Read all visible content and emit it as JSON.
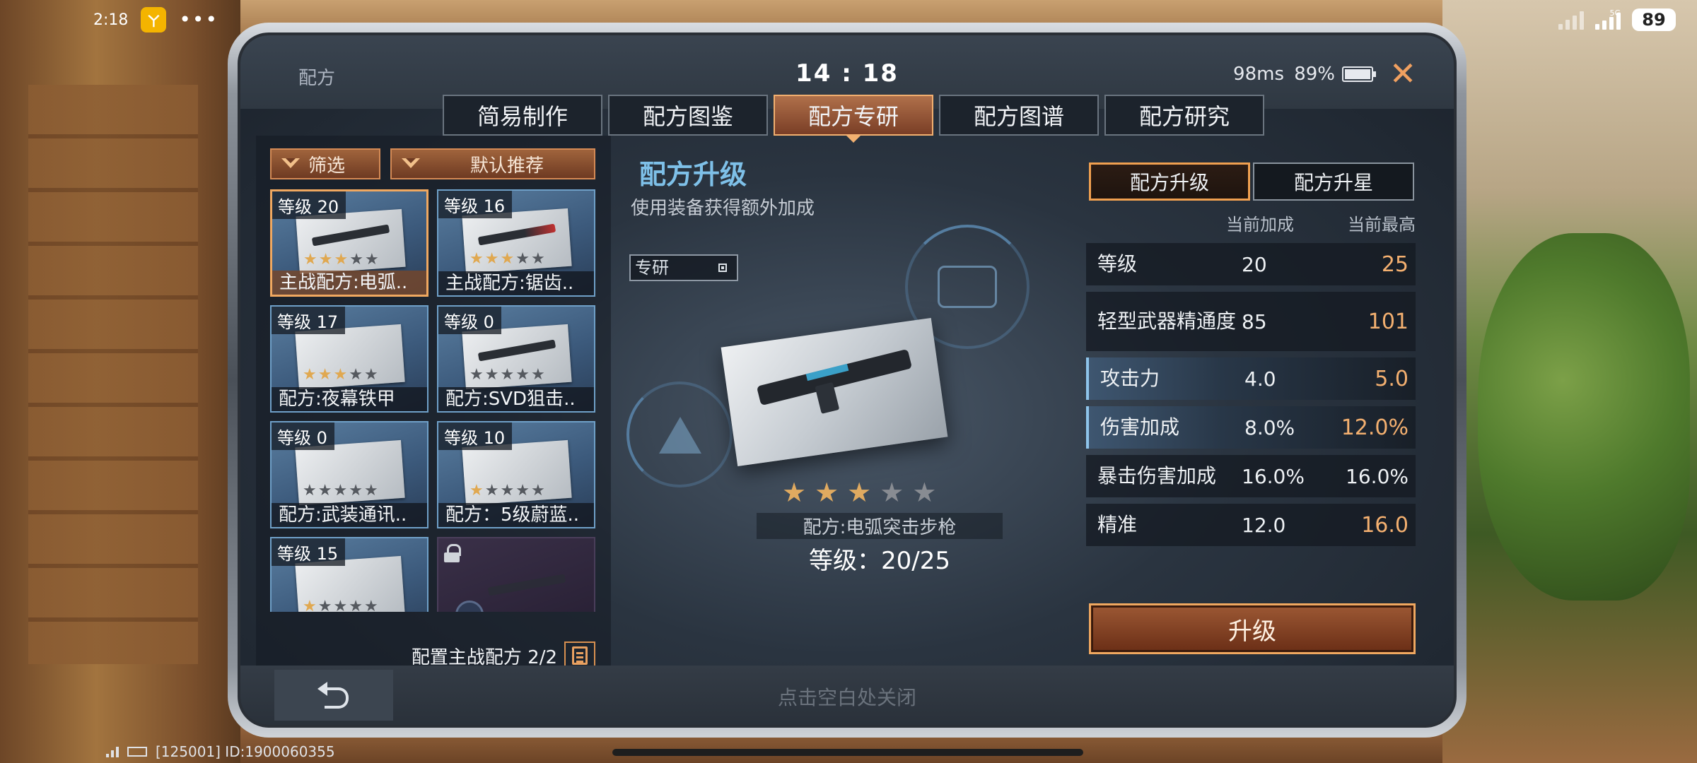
{
  "status_bar": {
    "time": "2:18",
    "app_badge": "ㄚ",
    "more": "•••",
    "network_tag": "5G",
    "battery": "89"
  },
  "window": {
    "title": "配方",
    "clock": "14 : 18",
    "ping": "98ms",
    "battery": "89%",
    "close_icon": "close-icon"
  },
  "tabs": [
    {
      "label": "简易制作",
      "active": false
    },
    {
      "label": "配方图鉴",
      "active": false
    },
    {
      "label": "配方专研",
      "active": true
    },
    {
      "label": "配方图谱",
      "active": false
    },
    {
      "label": "配方研究",
      "active": false
    }
  ],
  "list": {
    "filter_label": "筛选",
    "sort_label": "默认推荐",
    "cards": [
      {
        "level": "等级 20",
        "name": "主战配方:电弧..",
        "stars": 3,
        "selected": true
      },
      {
        "level": "等级 16",
        "name": "主战配方:锯齿..",
        "stars": 3
      },
      {
        "level": "等级 17",
        "name": "配方:夜幕铁甲",
        "stars": 3
      },
      {
        "level": "等级 0",
        "name": "配方:SVD狙击..",
        "stars": 0
      },
      {
        "level": "等级 0",
        "name": "配方:武装通讯..",
        "stars": 0
      },
      {
        "level": "等级 10",
        "name": "配方：5级蔚蓝..",
        "stars": 1
      },
      {
        "level": "等级 15",
        "name": "",
        "stars": 1
      },
      {
        "level": "",
        "name": "",
        "stars": 0,
        "locked": true
      }
    ],
    "config_text": "配置主战配方 2/2"
  },
  "detail": {
    "title": "配方升级",
    "subtitle": "使用装备获得额外加成",
    "research_toggle": "专研",
    "stars_on": 3,
    "stars_total": 5,
    "name": "配方:电弧突击步枪",
    "level": "等级：20/25"
  },
  "stats_panel": {
    "sub_tabs": [
      {
        "label": "配方升级",
        "active": true
      },
      {
        "label": "配方升星",
        "active": false
      }
    ],
    "col_current": "当前加成",
    "col_max": "当前最高",
    "rows": [
      {
        "name": "等级",
        "current": "20",
        "max": "25"
      },
      {
        "name": "轻型武器精通度",
        "current": "85",
        "max": "101"
      },
      {
        "name": "攻击力",
        "current": "4.0",
        "max": "5.0"
      },
      {
        "name": "伤害加成",
        "current": "8.0%",
        "max": "12.0%"
      },
      {
        "name": "暴击伤害加成",
        "current": "16.0%",
        "max": "16.0%"
      },
      {
        "name": "精准",
        "current": "12.0",
        "max": "16.0"
      }
    ],
    "upgrade_label": "升级"
  },
  "bottom": {
    "hint": "点击空白处关闭",
    "device_id": "[125001] ID:1900060355"
  },
  "colors": {
    "accent_orange": "#f0a860",
    "title_blue": "#7ec0e8",
    "max_value": "#f4b070"
  }
}
